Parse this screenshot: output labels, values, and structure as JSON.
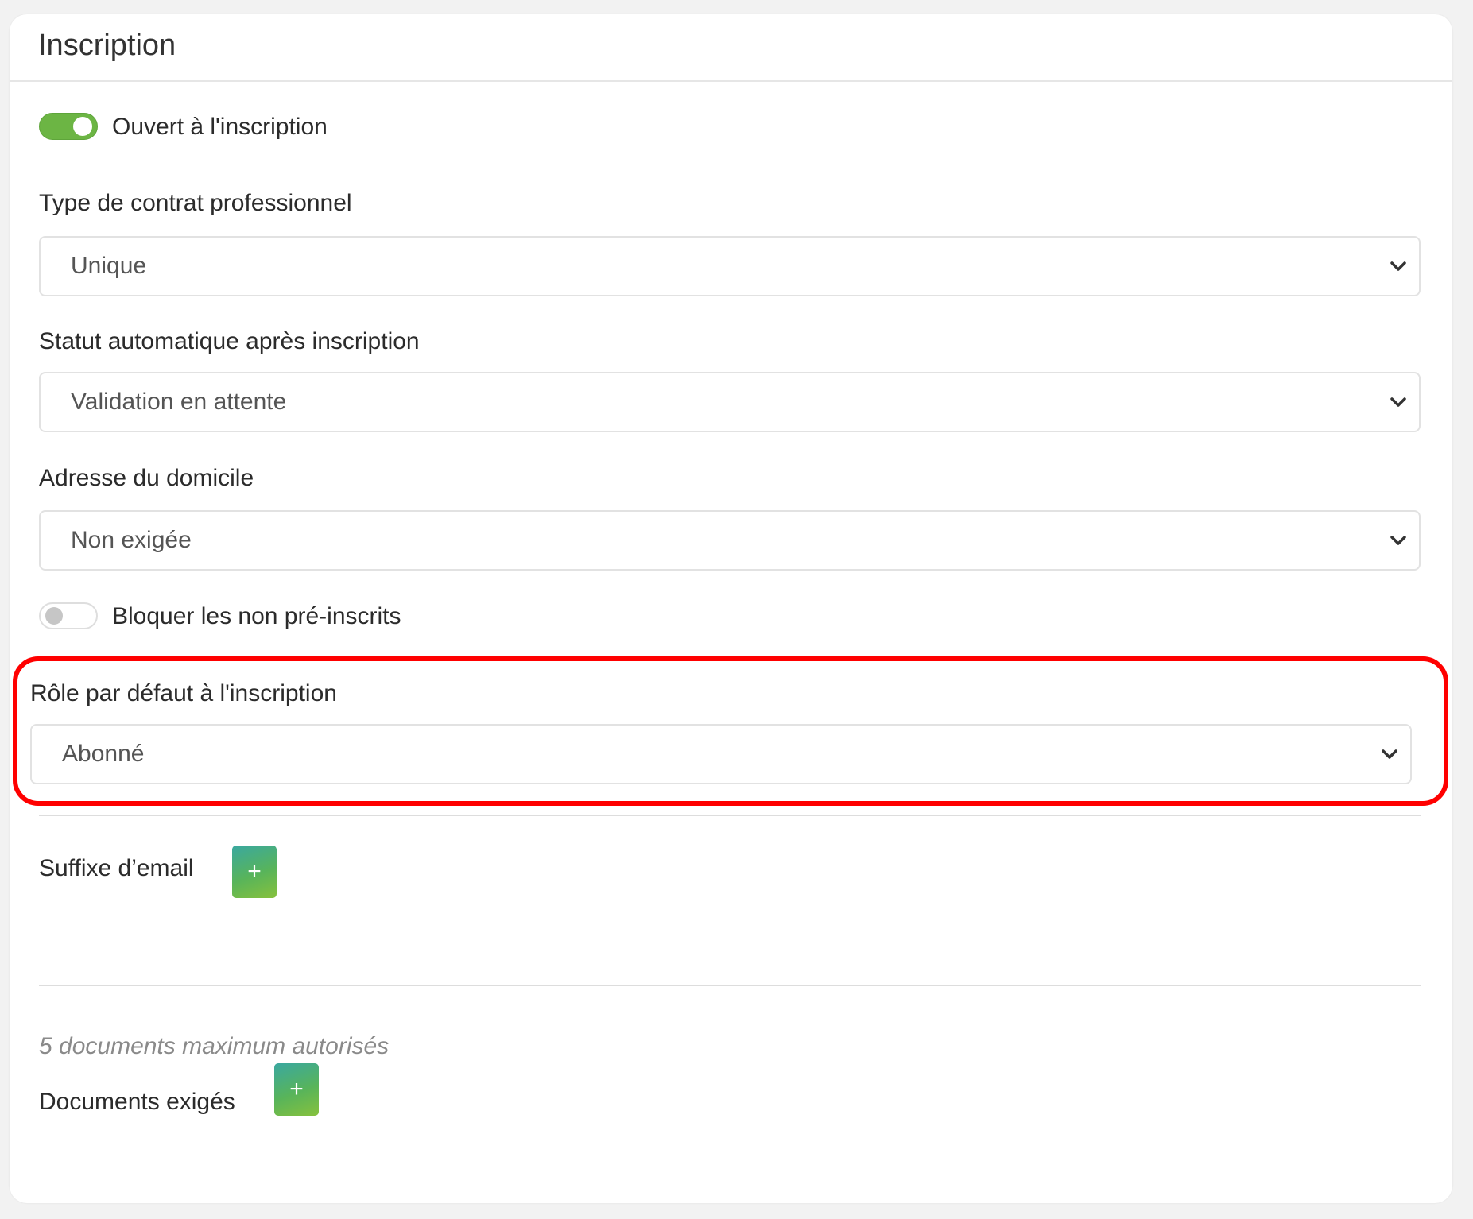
{
  "panel": {
    "title": "Inscription"
  },
  "open_registration": {
    "label": "Ouvert à l'inscription",
    "enabled": true
  },
  "contract_type": {
    "label": "Type de contrat professionnel",
    "value": "Unique"
  },
  "auto_status": {
    "label": "Statut automatique après inscription",
    "value": "Validation en attente"
  },
  "home_address": {
    "label": "Adresse du domicile",
    "value": "Non exigée"
  },
  "block_non_preregistered": {
    "label": "Bloquer les non pré-inscrits",
    "enabled": false
  },
  "default_role": {
    "label": "Rôle par défaut à l'inscription",
    "value": "Abonné"
  },
  "email_suffix": {
    "label": "Suffixe d’email",
    "add_label": "+"
  },
  "documents": {
    "limit_note": "5 documents maximum autorisés",
    "label": "Documents exigés",
    "add_label": "+"
  },
  "colors": {
    "toggle_on": "#6cb544",
    "highlight": "#ff0000",
    "button_gradient_start": "#3aa8a0",
    "button_gradient_end": "#86c13d"
  }
}
